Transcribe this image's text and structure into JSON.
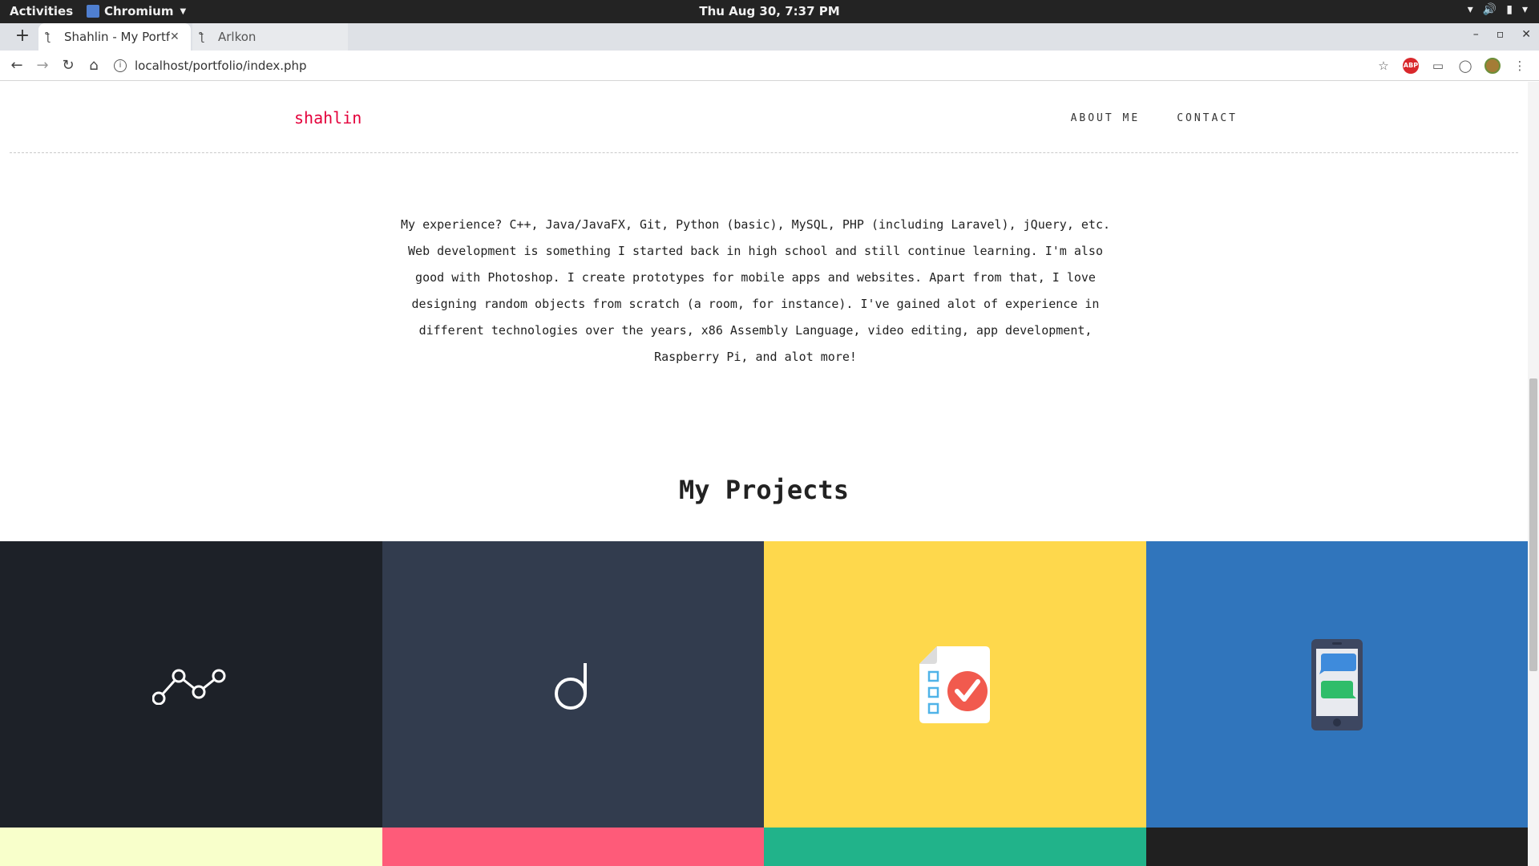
{
  "system_bar": {
    "activities": "Activities",
    "app_name": "Chromium",
    "clock": "Thu Aug 30,  7:37 PM"
  },
  "browser": {
    "tabs": [
      {
        "title": "Shahlin - My Portfo",
        "active": true
      },
      {
        "title": "Arlkon",
        "active": false
      }
    ],
    "url": "localhost/portfolio/index.php"
  },
  "site": {
    "brand": "shahlin",
    "nav": [
      "ABOUT ME",
      "CONTACT"
    ],
    "about_lines": [
      "My experience? C++, Java/JavaFX, Git, Python (basic), MySQL, PHP (including Laravel), jQuery, etc.",
      "Web development is something I started back in high school and still continue learning. I'm also",
      "good with Photoshop. I create prototypes for mobile apps and websites. Apart from that, I love",
      "designing random objects from scratch (a room, for instance). I've gained alot of experience in",
      "different technologies over the years, x86 Assembly Language, video editing, app development,",
      "Raspberry Pi, and alot more!"
    ],
    "projects_heading": "My Projects",
    "project_tiles": [
      {
        "icon": "line-graph-icon",
        "color": "#1d2128"
      },
      {
        "icon": "letter-d-logo-icon",
        "color": "#323c4e"
      },
      {
        "icon": "checklist-document-icon",
        "color": "#fed84c"
      },
      {
        "icon": "chat-phone-icon",
        "color": "#3075bc"
      },
      {
        "icon": "",
        "color": "#f8ffcb"
      },
      {
        "icon": "",
        "color": "#fe5b79"
      },
      {
        "icon": "",
        "color": "#21b38a"
      },
      {
        "icon": "",
        "color": "#202020"
      }
    ]
  }
}
